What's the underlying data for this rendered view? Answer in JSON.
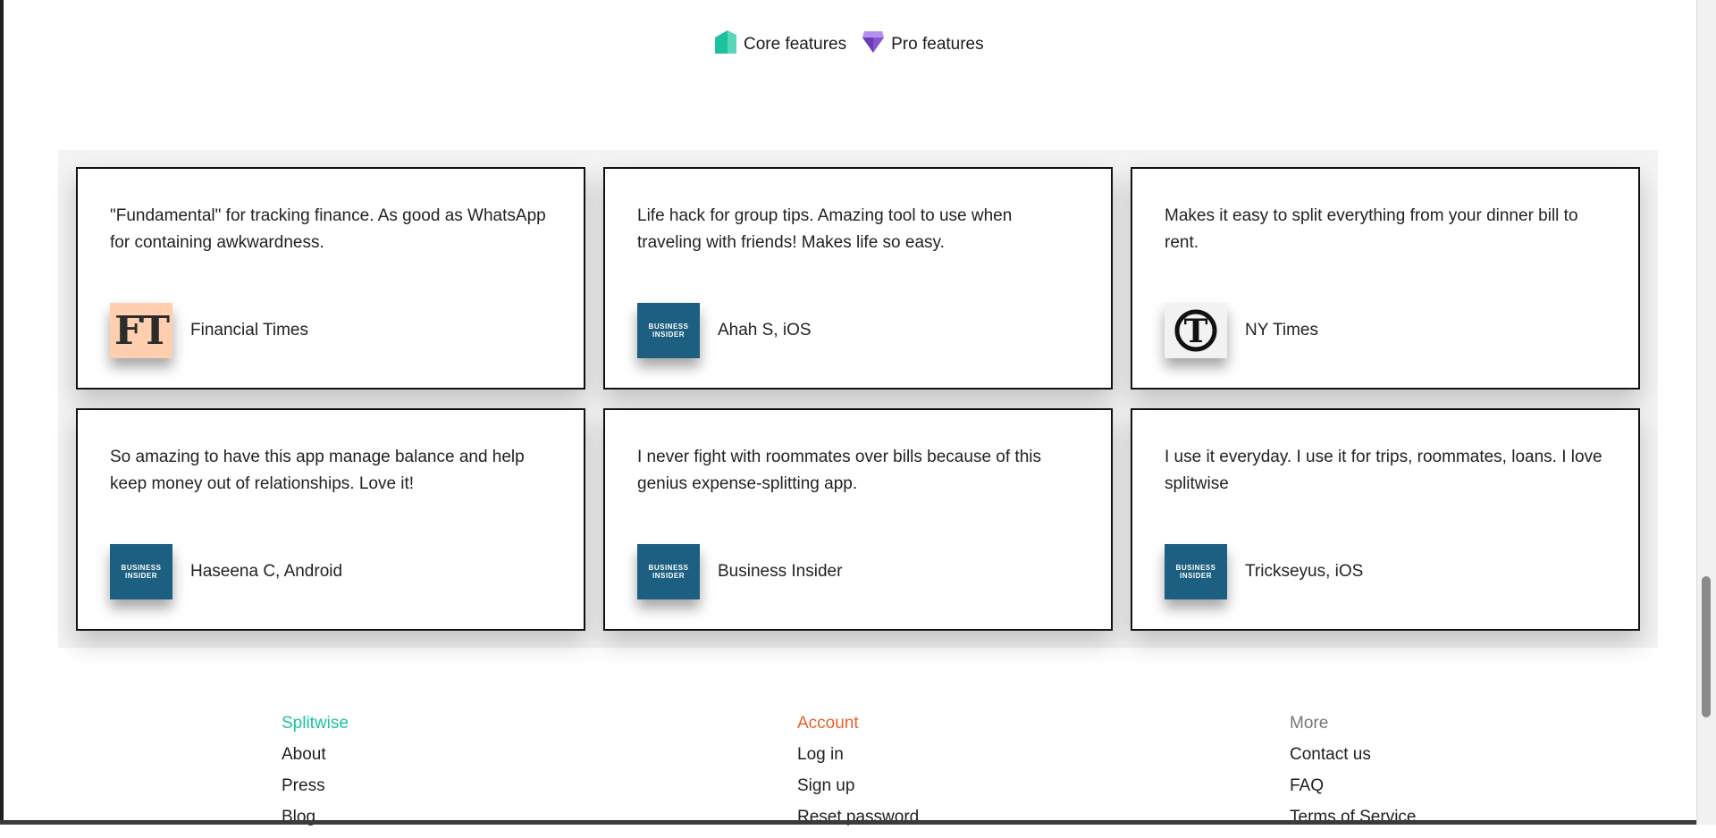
{
  "legend": {
    "core_label": "Core features",
    "pro_label": "Pro features",
    "core_color": "#1cc29f",
    "pro_color": "#8656cd"
  },
  "testimonials": [
    {
      "quote": "\"Fundamental\" for tracking finance. As good as WhatsApp for containing awkwardness.",
      "author": "Financial Times",
      "logo": "ft-logo",
      "logo_text": "FT"
    },
    {
      "quote": "Life hack for group tips. Amazing tool to use when traveling with friends! Makes life so easy.",
      "author": "Ahah S, iOS",
      "logo": "business-insider-logo",
      "logo_text": "BUSINESS INSIDER"
    },
    {
      "quote": "Makes it easy to split everything from your dinner bill to rent.",
      "author": "NY Times",
      "logo": "nyt-logo",
      "logo_text": "T"
    },
    {
      "quote": "So amazing to have this app manage balance and help keep money out of relationships. Love it!",
      "author": "Haseena C, Android",
      "logo": "business-insider-logo",
      "logo_text": "BUSINESS INSIDER"
    },
    {
      "quote": "I never fight with roommates over bills because of this genius expense-splitting app.",
      "author": "Business Insider",
      "logo": "business-insider-logo",
      "logo_text": "BUSINESS INSIDER"
    },
    {
      "quote": "I use it everyday. I use it for trips, roommates, loans. I love splitwise",
      "author": "Trickseyus, iOS",
      "logo": "business-insider-logo",
      "logo_text": "BUSINESS INSIDER"
    }
  ],
  "footer": {
    "splitwise": {
      "heading": "Splitwise",
      "color": "#1cc29f",
      "links": [
        "About",
        "Press",
        "Blog"
      ]
    },
    "account": {
      "heading": "Account",
      "color": "#e5622e",
      "links": [
        "Log in",
        "Sign up",
        "Reset password"
      ]
    },
    "more": {
      "heading": "More",
      "color": "#777777",
      "links": [
        "Contact us",
        "FAQ",
        "Terms of Service"
      ]
    }
  }
}
